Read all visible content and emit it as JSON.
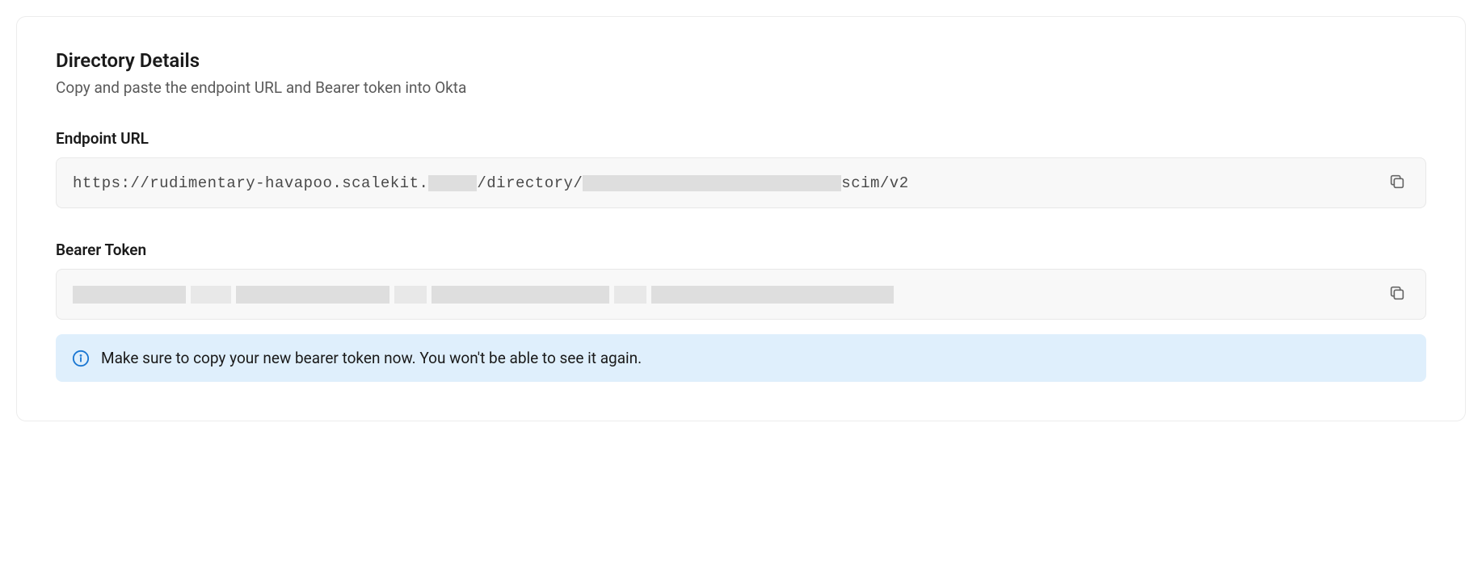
{
  "header": {
    "title": "Directory Details",
    "subtitle": "Copy and paste the endpoint URL and Bearer token into Okta"
  },
  "endpoint": {
    "label": "Endpoint URL",
    "url_part1": "https://rudimentary-havapoo.scalekit.",
    "url_part2": "/directory/",
    "url_part3": "scim/v2"
  },
  "bearer": {
    "label": "Bearer Token"
  },
  "info": {
    "message": "Make sure to copy your new bearer token now. You won't be able to see it again."
  }
}
